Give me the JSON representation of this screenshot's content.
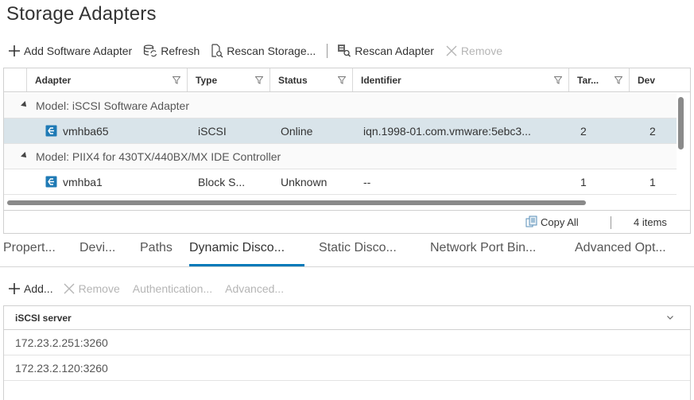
{
  "page": {
    "title": "Storage Adapters"
  },
  "toolbar": {
    "add_label": "Add Software Adapter",
    "refresh_label": "Refresh",
    "rescan_storage_label": "Rescan Storage...",
    "rescan_adapter_label": "Rescan Adapter",
    "remove_label": "Remove"
  },
  "adapters": {
    "columns": [
      "Adapter",
      "Type",
      "Status",
      "Identifier",
      "Tar...",
      "Dev"
    ],
    "groups": [
      {
        "label": "Model: iSCSI Software Adapter",
        "rows": [
          {
            "adapter": "vmhba65",
            "type": "iSCSI",
            "status": "Online",
            "identifier": "iqn.1998-01.com.vmware:5ebc3...",
            "targets": "2",
            "devices": "2"
          }
        ]
      },
      {
        "label": "Model: PIIX4 for 430TX/440BX/MX IDE Controller",
        "rows": [
          {
            "adapter": "vmhba1",
            "type": "Block S...",
            "status": "Unknown",
            "identifier": "--",
            "targets": "1",
            "devices": "1"
          }
        ]
      }
    ],
    "footer": {
      "copy_all": "Copy All",
      "count": "4 items"
    }
  },
  "tabs": [
    {
      "label": "Propert..."
    },
    {
      "label": "Devi..."
    },
    {
      "label": "Paths"
    },
    {
      "label": "Dynamic Disco...",
      "active": true
    },
    {
      "label": "Static Disco..."
    },
    {
      "label": "Network Port Bin..."
    },
    {
      "label": "Advanced Opt..."
    }
  ],
  "discovery_toolbar": {
    "add_label": "Add...",
    "remove_label": "Remove",
    "auth_label": "Authentication...",
    "advanced_label": "Advanced..."
  },
  "servers": {
    "header": "iSCSI server",
    "rows": [
      "172.23.2.251:3260",
      "172.23.2.120:3260"
    ]
  },
  "colors": {
    "accent": "#0079b8",
    "selected_row": "#d9e4ea",
    "disabled": "#b5b5b5",
    "adapter_icon": "#1f7ab5"
  }
}
